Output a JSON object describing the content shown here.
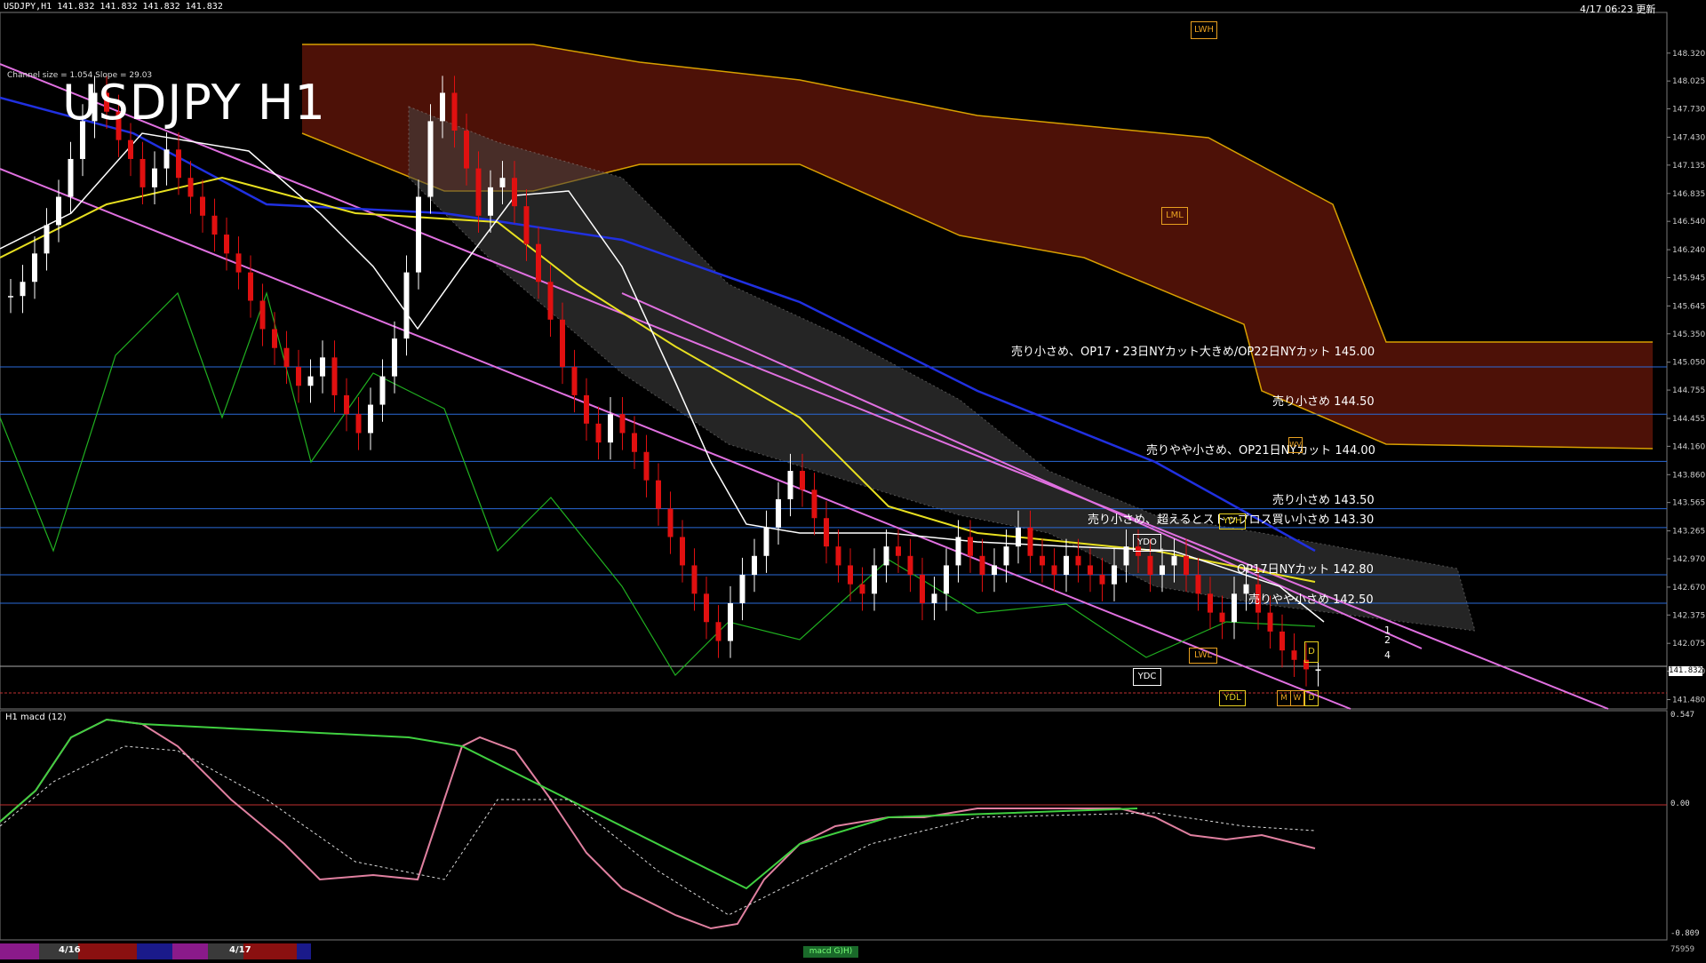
{
  "header": {
    "info": "USDJPY,H1  141.832 141.832 141.832 141.832",
    "timestamp": "4/17 06:23 更新",
    "channel_size": "Channel size = 1.054 Slope = 29.03"
  },
  "watermark": "USDJPY H1",
  "levels": [
    {
      "price": 145.0,
      "label": "売り小さめ、OP17・23日NYカット大きめ/OP22日NYカット 145.00"
    },
    {
      "price": 144.5,
      "label": "売り小さめ 144.50"
    },
    {
      "price": 144.0,
      "label": "売りやや小さめ、OP21日NYカット 144.00"
    },
    {
      "price": 143.5,
      "label": "売り小さめ 143.50"
    },
    {
      "price": 143.3,
      "label": "売り小さめ、超えるとストップロス買い小さめ 143.30"
    },
    {
      "price": 142.8,
      "label": "OP17日NYカット 142.80"
    },
    {
      "price": 142.5,
      "label": "売りやや小さめ 142.50"
    }
  ],
  "price_axis": {
    "ticks": [
      "148.320",
      "148.025",
      "147.730",
      "147.430",
      "147.135",
      "146.835",
      "146.540",
      "146.240",
      "145.945",
      "145.645",
      "145.350",
      "145.050",
      "144.755",
      "144.455",
      "144.160",
      "143.860",
      "143.565",
      "143.265",
      "142.970",
      "142.670",
      "142.375",
      "142.075",
      "141.780",
      "141.480"
    ],
    "current": "141.832"
  },
  "markers": {
    "lwh": "LWH",
    "lwl": "LWL",
    "lml": "LML",
    "wv": "WV",
    "ydh": "YDH",
    "ydo": "YDO",
    "ydc": "YDC",
    "ydl": "YDL",
    "d": "D",
    "m": "M",
    "w": "W"
  },
  "ma_labels": [
    "1",
    "2",
    "4"
  ],
  "macd": {
    "label": "H1  macd (12)",
    "ticks": [
      "0.547",
      "0.00",
      "-0.809"
    ]
  },
  "date_bar": {
    "date1": "4/16",
    "date2": "4/17",
    "tab": "macd G)H)",
    "corner": "75959"
  },
  "chart_data": {
    "type": "candlestick",
    "title": "USDJPY H1",
    "ylim": [
      141.4,
      148.6
    ],
    "closes": [
      145.75,
      145.9,
      146.2,
      146.5,
      146.8,
      147.2,
      147.6,
      147.9,
      147.7,
      147.4,
      147.2,
      146.9,
      147.1,
      147.3,
      147.0,
      146.8,
      146.6,
      146.4,
      146.2,
      146.0,
      145.7,
      145.4,
      145.2,
      145.0,
      144.8,
      144.9,
      145.1,
      144.7,
      144.5,
      144.3,
      144.6,
      144.9,
      145.3,
      146.0,
      146.8,
      147.6,
      147.9,
      147.5,
      147.1,
      146.6,
      146.9,
      147.0,
      146.7,
      146.3,
      145.9,
      145.5,
      145.0,
      144.7,
      144.4,
      144.2,
      144.5,
      144.3,
      144.1,
      143.8,
      143.5,
      143.2,
      142.9,
      142.6,
      142.3,
      142.1,
      142.5,
      142.8,
      143.0,
      143.3,
      143.6,
      143.9,
      143.7,
      143.4,
      143.1,
      142.9,
      142.7,
      142.6,
      142.9,
      143.1,
      143.0,
      142.8,
      142.5,
      142.6,
      142.9,
      143.2,
      143.0,
      142.8,
      142.9,
      143.1,
      143.3,
      143.0,
      142.9,
      142.8,
      143.0,
      142.9,
      142.8,
      142.7,
      142.9,
      143.1,
      143.0,
      142.8,
      142.9,
      143.0,
      142.8,
      142.6,
      142.4,
      142.3,
      142.6,
      142.7,
      142.4,
      142.2,
      142.0,
      141.9,
      141.8,
      141.8
    ]
  }
}
